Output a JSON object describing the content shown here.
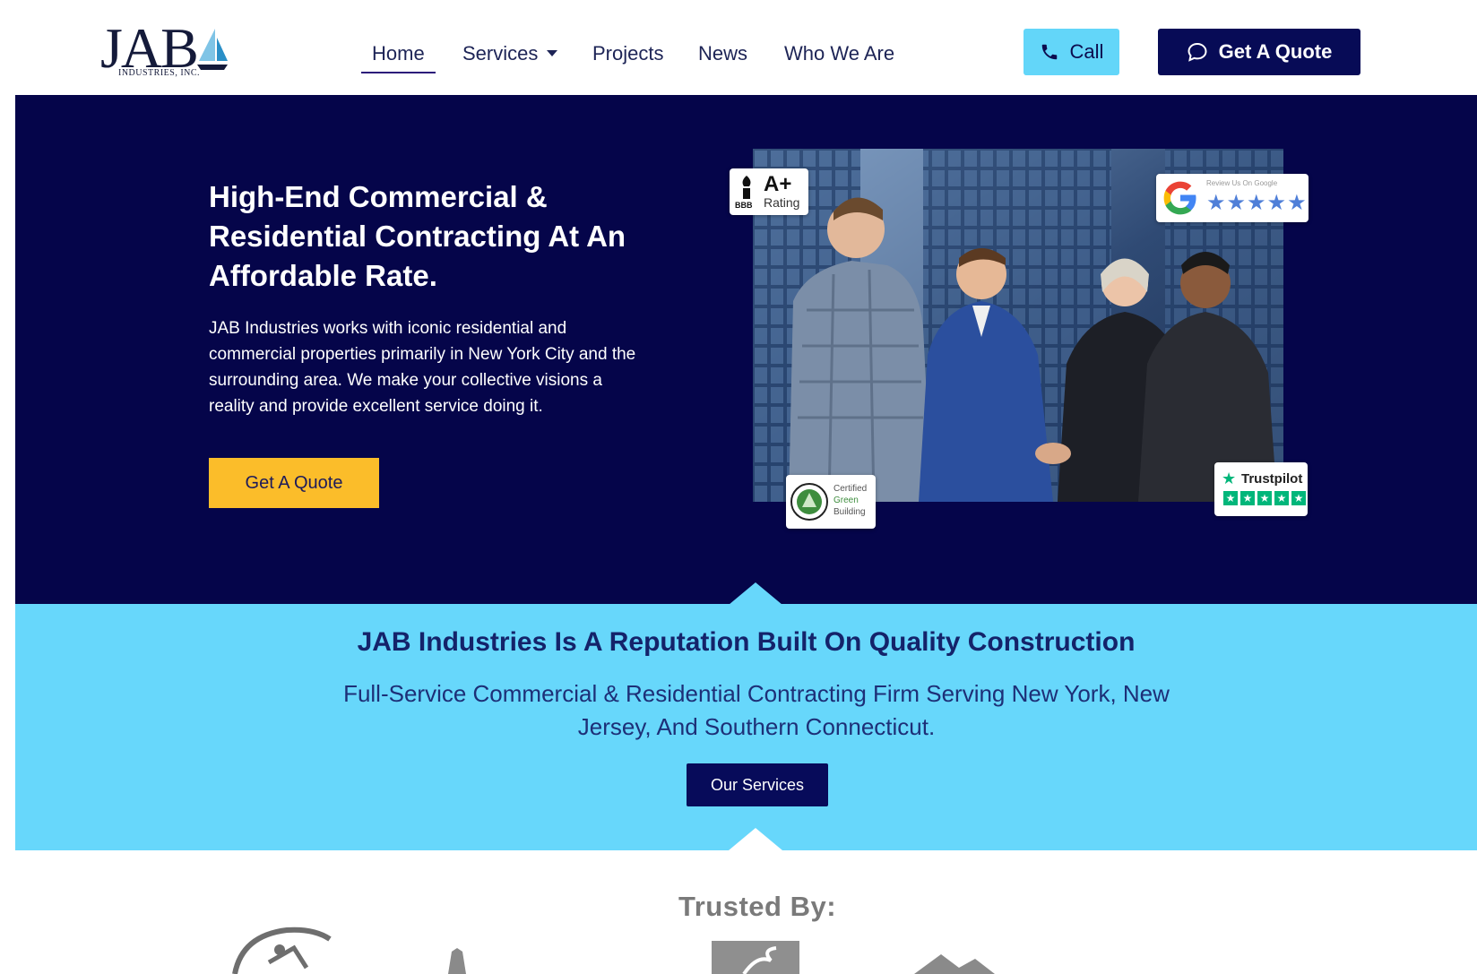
{
  "header": {
    "logo_text": "JAB",
    "logo_subtext": "INDUSTRIES, INC.",
    "nav": [
      {
        "label": "Home",
        "active": true
      },
      {
        "label": "Services",
        "dropdown": true
      },
      {
        "label": "Projects"
      },
      {
        "label": "News"
      },
      {
        "label": "Who We Are"
      }
    ],
    "call_label": "Call",
    "quote_label": "Get A Quote"
  },
  "hero": {
    "title": "High-End Commercial & Residential Contracting At An Affordable Rate.",
    "description": "JAB Industries works with iconic residential and commercial properties primarily in New York City and the surrounding area. We make your collective visions a reality and provide excellent service doing it.",
    "cta_label": "Get A Quote",
    "badges": {
      "bbb_grade": "A+",
      "bbb_label": "Rating",
      "bbb_mark": "BBB",
      "google_caption": "Review Us On Google",
      "google_stars": "★★★★★",
      "green_line1": "Certified",
      "green_line2": "Green",
      "green_line3": "Building",
      "trustpilot_label": "Trustpilot"
    }
  },
  "band": {
    "title": "JAB Industries Is A Reputation Built On Quality Construction",
    "subtitle": "Full-Service Commercial & Residential Contracting Firm Serving New York, New Jersey, And Southern Connecticut.",
    "button_label": "Our Services"
  },
  "trusted": {
    "heading": "Trusted By:"
  },
  "colors": {
    "navy": "#05054a",
    "cyan": "#67d7fb",
    "yellow": "#fbbd2a",
    "dark_button": "#070b56"
  }
}
